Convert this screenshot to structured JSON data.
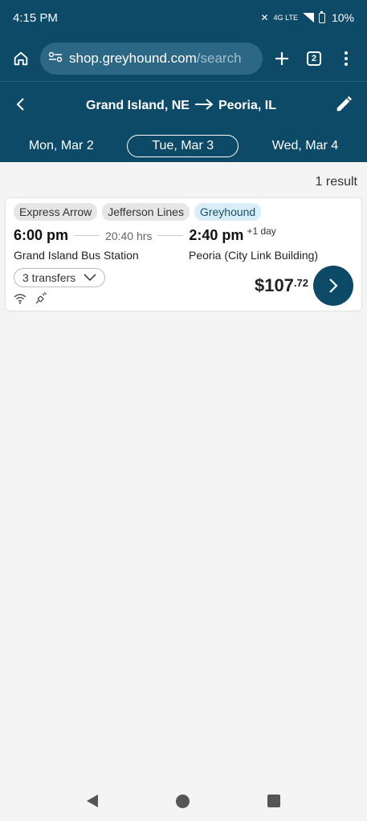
{
  "status": {
    "time": "4:15 PM",
    "network": "4G LTE",
    "battery": "10%"
  },
  "browser": {
    "url_host": "shop.greyhound.com",
    "url_path": "/search",
    "tab_count": "2"
  },
  "route": {
    "origin": "Grand Island, NE",
    "destination": "Peoria, IL"
  },
  "dates": [
    {
      "label": "Mon, Mar 2"
    },
    {
      "label": "Tue, Mar 3"
    },
    {
      "label": "Wed, Mar 4"
    }
  ],
  "results": {
    "count_text": "1 result",
    "items": [
      {
        "carriers": [
          "Express Arrow",
          "Jefferson Lines",
          "Greyhound"
        ],
        "depart_time": "6:00 pm",
        "duration": "20:40 hrs",
        "arrive_time": "2:40 pm",
        "day_offset": "+1 day",
        "depart_station": "Grand Island Bus Station",
        "arrive_station": "Peoria (City Link Building)",
        "transfers": "3 transfers",
        "amenities": [
          "wifi-icon",
          "power-outlet-icon"
        ],
        "price_whole": "$107",
        "price_cents": ".72"
      }
    ]
  },
  "colors": {
    "brand": "#0d4a68",
    "brand_tag": "#d9eef8"
  }
}
